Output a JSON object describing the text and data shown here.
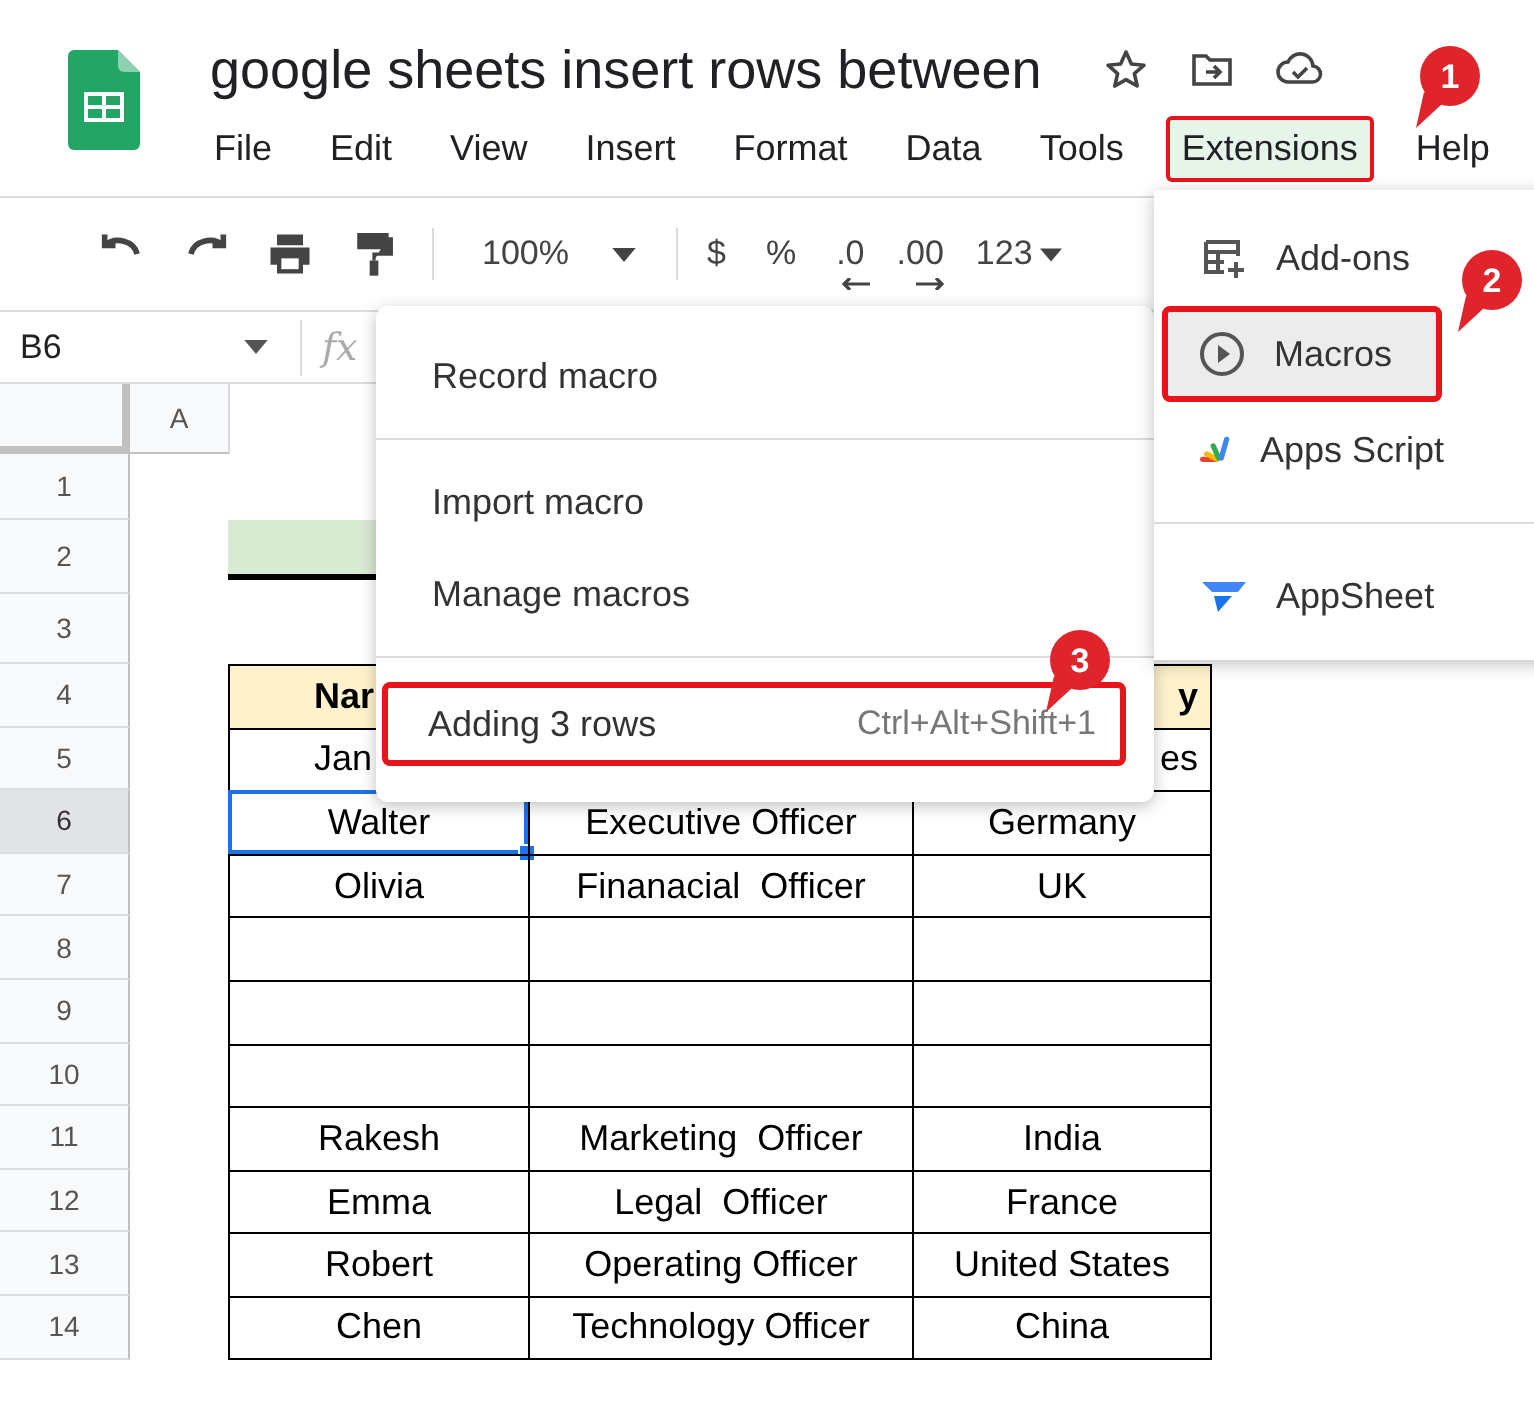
{
  "document": {
    "title": "google sheets insert rows between"
  },
  "menu_bar": [
    {
      "label": "File",
      "selected": false,
      "highlighted": false
    },
    {
      "label": "Edit",
      "selected": false,
      "highlighted": false
    },
    {
      "label": "View",
      "selected": false,
      "highlighted": false
    },
    {
      "label": "Insert",
      "selected": false,
      "highlighted": false
    },
    {
      "label": "Format",
      "selected": false,
      "highlighted": false
    },
    {
      "label": "Data",
      "selected": false,
      "highlighted": false
    },
    {
      "label": "Tools",
      "selected": false,
      "highlighted": false
    },
    {
      "label": "Extensions",
      "selected": true,
      "highlighted": true
    },
    {
      "label": "Help",
      "selected": false,
      "highlighted": false
    }
  ],
  "toolbar": {
    "zoom": "100%",
    "currency": "$",
    "percent": "%",
    "decrease_decimals": ".0",
    "increase_decimals": ".00",
    "number_format": "123"
  },
  "formula_bar": {
    "name_box": "B6",
    "label": "fx"
  },
  "column_headers": [
    {
      "label": "A",
      "selected": false
    }
  ],
  "row_headers": [
    {
      "label": "1",
      "selected": false
    },
    {
      "label": "2",
      "selected": false
    },
    {
      "label": "3",
      "selected": false
    },
    {
      "label": "4",
      "selected": false
    },
    {
      "label": "5",
      "selected": false
    },
    {
      "label": "6",
      "selected": true
    },
    {
      "label": "7",
      "selected": false
    },
    {
      "label": "8",
      "selected": false
    },
    {
      "label": "9",
      "selected": false
    },
    {
      "label": "10",
      "selected": false
    },
    {
      "label": "11",
      "selected": false
    },
    {
      "label": "12",
      "selected": false
    },
    {
      "label": "13",
      "selected": false
    },
    {
      "label": "14",
      "selected": false
    }
  ],
  "table": {
    "rows": [
      {
        "kind": "header",
        "cells": [
          {
            "text": "Nar"
          },
          {},
          {
            "text": "y"
          }
        ]
      },
      {
        "kind": "covered",
        "cells": [
          {
            "text": "Jan"
          },
          {},
          {
            "text": "es"
          }
        ]
      },
      {
        "kind": "data",
        "cells": [
          {
            "text": "Walter",
            "selected": true
          },
          {
            "text": "Executive Officer",
            "selected": false
          },
          {
            "text": "Germany",
            "selected": false
          }
        ]
      },
      {
        "kind": "data",
        "cells": [
          {
            "text": "Olivia",
            "selected": false
          },
          {
            "text": "Finanacial  Officer",
            "selected": false
          },
          {
            "text": "UK",
            "selected": false
          }
        ]
      },
      {
        "kind": "data",
        "cells": [
          {
            "selected": false
          },
          {
            "selected": false
          },
          {
            "selected": false
          }
        ]
      },
      {
        "kind": "data",
        "cells": [
          {
            "selected": false
          },
          {
            "selected": false
          },
          {
            "selected": false
          }
        ]
      },
      {
        "kind": "data",
        "cells": [
          {
            "selected": false
          },
          {
            "selected": false
          },
          {
            "selected": false
          }
        ]
      },
      {
        "kind": "data",
        "cells": [
          {
            "text": "Rakesh",
            "selected": false
          },
          {
            "text": "Marketing  Officer",
            "selected": false
          },
          {
            "text": "India",
            "selected": false
          }
        ]
      },
      {
        "kind": "data",
        "cells": [
          {
            "text": "Emma",
            "selected": false
          },
          {
            "text": "Legal  Officer",
            "selected": false
          },
          {
            "text": "France",
            "selected": false
          }
        ]
      },
      {
        "kind": "data",
        "cells": [
          {
            "text": "Robert",
            "selected": false
          },
          {
            "text": "Operating Officer",
            "selected": false
          },
          {
            "text": "United States",
            "selected": false
          }
        ]
      },
      {
        "kind": "data",
        "cells": [
          {
            "text": "Chen",
            "selected": false
          },
          {
            "text": "Technology Officer",
            "selected": false
          },
          {
            "text": "China",
            "selected": false
          }
        ]
      }
    ]
  },
  "extensions_menu": {
    "sections": [
      {
        "items": [
          {
            "label": "Add-ons",
            "kind": "addons",
            "selected": false,
            "highlighted": false
          },
          {
            "label": "Macros",
            "kind": "macros",
            "selected": true,
            "highlighted": true
          },
          {
            "label": "Apps Script",
            "kind": "script",
            "selected": false,
            "highlighted": false
          }
        ]
      },
      {
        "items": [
          {
            "label": "AppSheet",
            "kind": "appsheet",
            "selected": false,
            "highlighted": false
          }
        ]
      }
    ]
  },
  "macros_menu": {
    "sections": [
      {
        "items": [
          {
            "label": "Record macro",
            "highlighted": false
          }
        ]
      },
      {
        "items": [
          {
            "label": "Import macro",
            "highlighted": false
          },
          {
            "label": "Manage macros",
            "highlighted": false
          }
        ]
      },
      {
        "items": [
          {
            "label": "Adding 3 rows",
            "shortcut": "Ctrl+Alt+Shift+1",
            "highlighted": true
          }
        ]
      }
    ]
  },
  "callouts": [
    {
      "label": "1"
    },
    {
      "label": "2"
    },
    {
      "label": "3"
    }
  ]
}
